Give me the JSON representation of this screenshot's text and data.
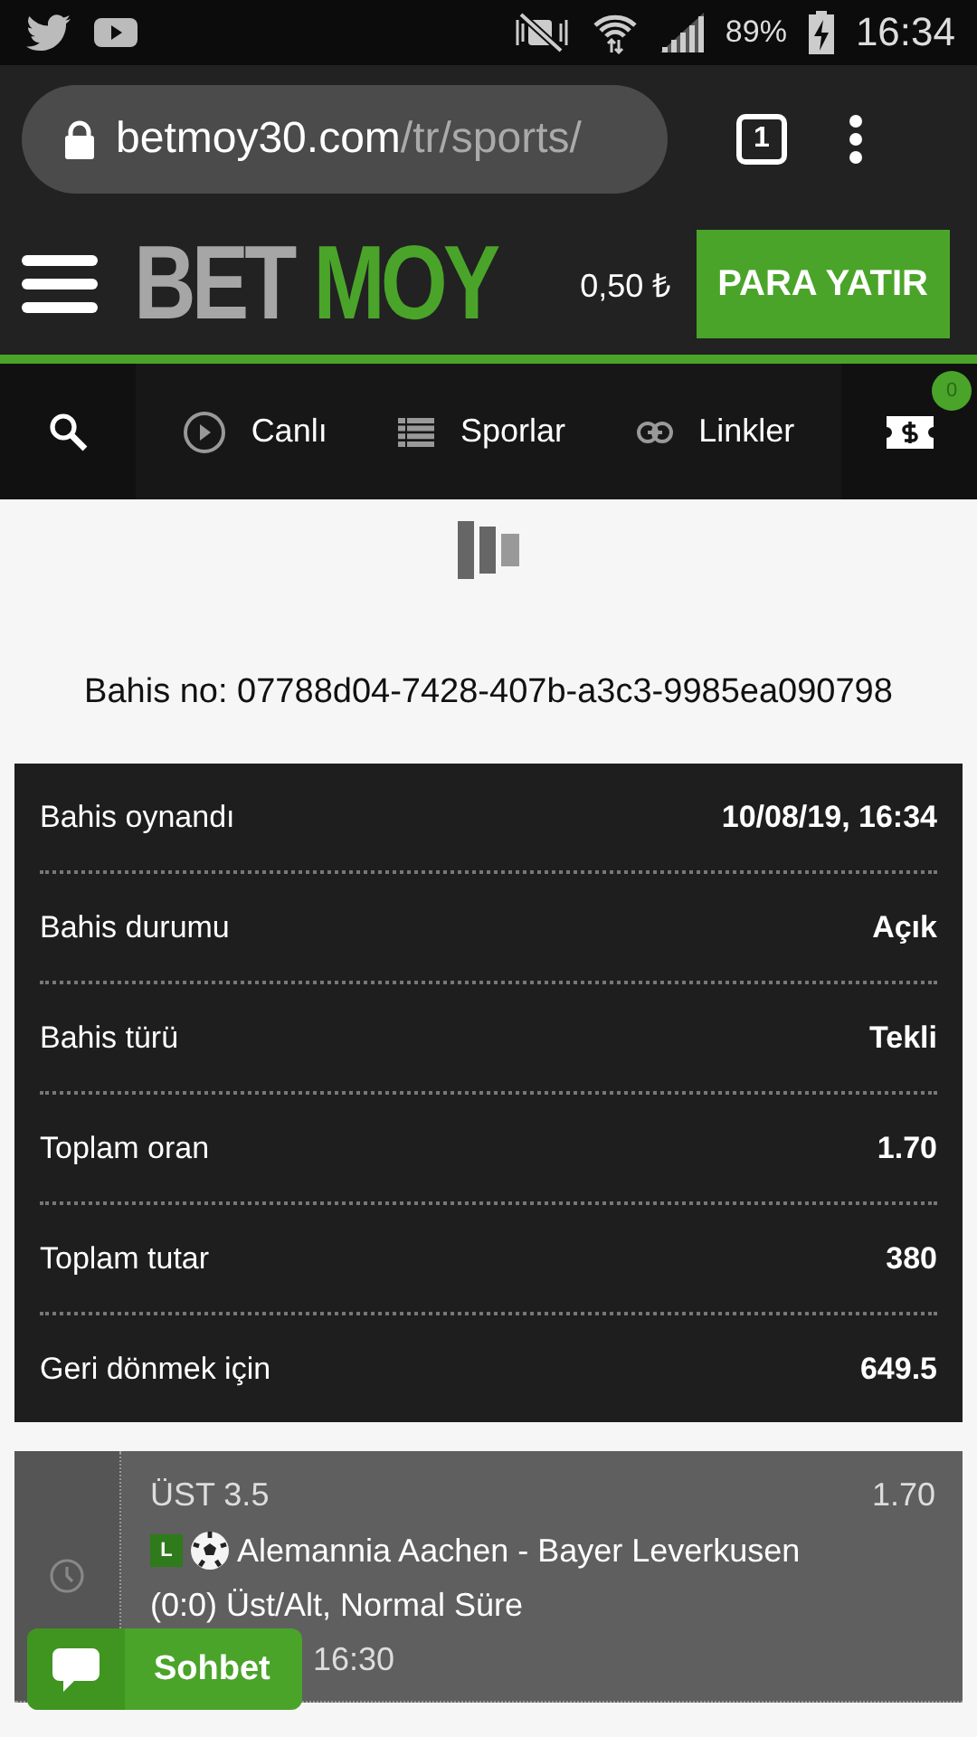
{
  "status_bar": {
    "battery": "89%",
    "time": "16:34"
  },
  "browser": {
    "url_host": "betmoy30.com",
    "url_path": "/tr/sports/",
    "tab_count": "1"
  },
  "header": {
    "logo_left": "BET",
    "logo_right": "MOY",
    "balance": "0,50 ₺",
    "deposit_button": "PARA YATIR"
  },
  "nav": {
    "items": [
      {
        "label": "Canlı",
        "kind": "live"
      },
      {
        "label": "Sporlar",
        "kind": "sports"
      },
      {
        "label": "Linkler",
        "kind": "links"
      }
    ],
    "betslip_count": "0"
  },
  "bet_number": "Bahis no: 07788d04-7428-407b-a3c3-9985ea090798",
  "details": [
    {
      "label": "Bahis oynandı",
      "value": "10/08/19, 16:34"
    },
    {
      "label": "Bahis durumu",
      "value": "Açık"
    },
    {
      "label": "Bahis türü",
      "value": "Tekli"
    },
    {
      "label": "Toplam oran",
      "value": "1.70"
    },
    {
      "label": "Toplam tutar",
      "value": "380"
    },
    {
      "label": "Geri dönmek için",
      "value": "649.5"
    }
  ],
  "selection": {
    "market": "ÜST 3.5",
    "odds": "1.70",
    "live_badge": "L",
    "event": "Alemannia Aachen - Bayer Leverkusen",
    "bet_type": "(0:0) Üst/Alt, Normal Süre",
    "time": "16:30"
  },
  "chat": {
    "label": "Sohbet"
  }
}
